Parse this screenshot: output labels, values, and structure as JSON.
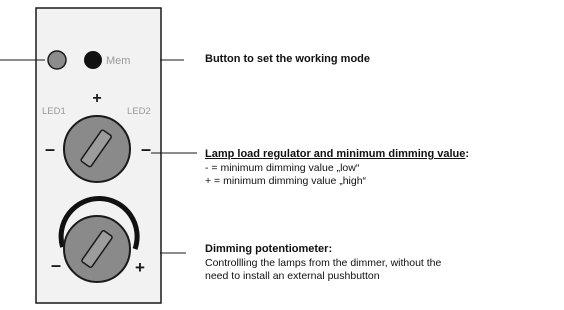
{
  "device": {
    "mem_label": "Mem",
    "knob1_left_label": "LED1",
    "knob1_right_label": "LED2",
    "knob1_plus": "+",
    "knob1_minus_left": "–",
    "knob1_minus_right": "–",
    "knob2_minus": "–",
    "knob2_plus": "+"
  },
  "annotations": {
    "mode_button": {
      "title": "Button to set the working mode"
    },
    "lamp_regulator": {
      "title": "Lamp load regulator and minimum dimming value",
      "colon": ":",
      "lines": [
        "- = minimum dimming value „low“",
        "+ = minimum dimming value „high“"
      ]
    },
    "potentiometer": {
      "title": "Dimming potentiometer:",
      "lines": [
        "Controllling the lamps from the dimmer, without the",
        "need to install an external pushbutton"
      ]
    }
  },
  "colors": {
    "panel_fill": "#f2f2f2",
    "outline": "#1a1a1a",
    "knob_fill": "#8a8a8a",
    "slot_fill": "#9c9c9c",
    "led_grey": "#8c8c8c",
    "led_black": "#111111",
    "label_grey": "#9a9a9a"
  }
}
